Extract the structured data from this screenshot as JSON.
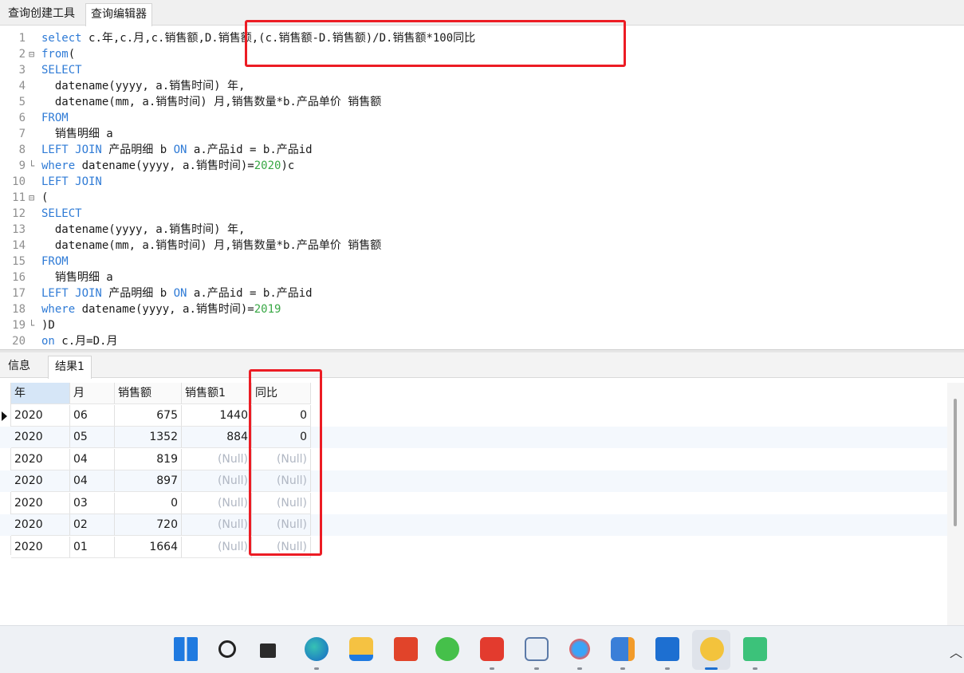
{
  "top_tabs": [
    "查询创建工具",
    "查询编辑器"
  ],
  "editor": {
    "lines": [
      {
        "n": "1",
        "fold": "",
        "segs": [
          [
            "kw",
            "select "
          ],
          [
            "",
            "c.年,c.月,c.销售额,D.销售额,(c.销售额-D.销售额)/D.销售额*100同比"
          ]
        ]
      },
      {
        "n": "2",
        "fold": "⊟",
        "segs": [
          [
            "kw",
            "from"
          ],
          [
            "",
            "("
          ]
        ]
      },
      {
        "n": "3",
        "fold": "",
        "segs": [
          [
            "kw",
            "SELECT"
          ]
        ]
      },
      {
        "n": "4",
        "fold": "",
        "segs": [
          [
            "",
            "  datename(yyyy, a.销售时间) 年,"
          ]
        ]
      },
      {
        "n": "5",
        "fold": "",
        "segs": [
          [
            "",
            "  datename(mm, a.销售时间) 月,销售数量*b.产品单价 销售额"
          ]
        ]
      },
      {
        "n": "6",
        "fold": "",
        "segs": [
          [
            "kw",
            "FROM"
          ]
        ]
      },
      {
        "n": "7",
        "fold": "",
        "segs": [
          [
            "",
            "  销售明细 a"
          ]
        ]
      },
      {
        "n": "8",
        "fold": "",
        "segs": [
          [
            "kw",
            "LEFT JOIN "
          ],
          [
            "",
            "产品明细 b "
          ],
          [
            "kw",
            "ON "
          ],
          [
            "",
            "a.产品id = b.产品id"
          ]
        ]
      },
      {
        "n": "9",
        "fold": "└",
        "segs": [
          [
            "kw",
            "where "
          ],
          [
            "",
            "datename(yyyy, a.销售时间)="
          ],
          [
            "num",
            "2020"
          ],
          [
            "",
            ")c"
          ]
        ]
      },
      {
        "n": "10",
        "fold": "",
        "segs": [
          [
            "kw",
            "LEFT JOIN"
          ]
        ]
      },
      {
        "n": "11",
        "fold": "⊟",
        "segs": [
          [
            "",
            "("
          ]
        ]
      },
      {
        "n": "12",
        "fold": "",
        "segs": [
          [
            "kw",
            "SELECT"
          ]
        ]
      },
      {
        "n": "13",
        "fold": "",
        "segs": [
          [
            "",
            "  datename(yyyy, a.销售时间) 年,"
          ]
        ]
      },
      {
        "n": "14",
        "fold": "",
        "segs": [
          [
            "",
            "  datename(mm, a.销售时间) 月,销售数量*b.产品单价 销售额"
          ]
        ]
      },
      {
        "n": "15",
        "fold": "",
        "segs": [
          [
            "kw",
            "FROM"
          ]
        ]
      },
      {
        "n": "16",
        "fold": "",
        "segs": [
          [
            "",
            "  销售明细 a"
          ]
        ]
      },
      {
        "n": "17",
        "fold": "",
        "segs": [
          [
            "kw",
            "LEFT JOIN "
          ],
          [
            "",
            "产品明细 b "
          ],
          [
            "kw",
            "ON "
          ],
          [
            "",
            "a.产品id = b.产品id"
          ]
        ]
      },
      {
        "n": "18",
        "fold": "",
        "segs": [
          [
            "kw",
            "where "
          ],
          [
            "",
            "datename(yyyy, a.销售时间)="
          ],
          [
            "num",
            "2019"
          ]
        ]
      },
      {
        "n": "19",
        "fold": "└",
        "segs": [
          [
            "",
            ")D"
          ]
        ]
      },
      {
        "n": "20",
        "fold": "",
        "segs": [
          [
            "kw",
            "on "
          ],
          [
            "",
            "c.月=D.月"
          ]
        ]
      }
    ]
  },
  "result_tabs": [
    "信息",
    "结果1"
  ],
  "grid": {
    "columns": [
      "年",
      "月",
      "销售额",
      "销售额1",
      "同比"
    ],
    "rows": [
      [
        "2020",
        "06",
        "675",
        "1440",
        "0"
      ],
      [
        "2020",
        "05",
        "1352",
        "884",
        "0"
      ],
      [
        "2020",
        "04",
        "819",
        "(Null)",
        "(Null)"
      ],
      [
        "2020",
        "04",
        "897",
        "(Null)",
        "(Null)"
      ],
      [
        "2020",
        "03",
        "0",
        "(Null)",
        "(Null)"
      ],
      [
        "2020",
        "02",
        "720",
        "(Null)",
        "(Null)"
      ],
      [
        "2020",
        "01",
        "1664",
        "(Null)",
        "(Null)"
      ]
    ]
  },
  "taskbar": {
    "icons": [
      "windows-start-icon",
      "search-icon",
      "task-view-icon",
      "edge-browser-icon",
      "file-explorer-icon",
      "office-icon",
      "wechat-icon",
      "wps-office-icon",
      "java-icon",
      "baidu-netdisk-icon",
      "archive-tool-icon",
      "feishu-icon",
      "navicat-icon",
      "sublime-text-icon"
    ]
  },
  "colors": {
    "keyword": "#2f7bd6",
    "number": "#39a845",
    "highlight": "#ec1c24"
  }
}
